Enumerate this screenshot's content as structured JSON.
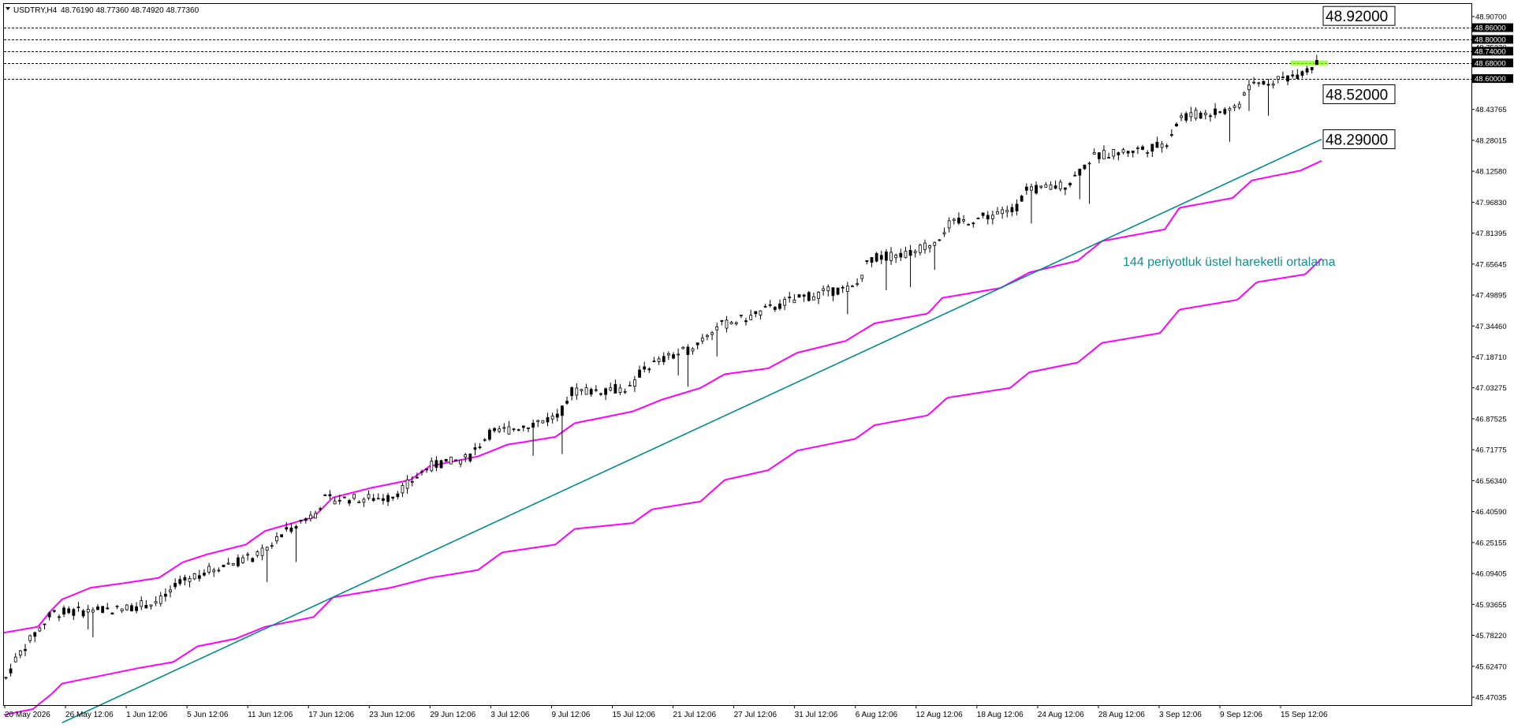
{
  "header": {
    "symbol": "USDTRY,H4",
    "ohlc": "48.76190 48.77360 48.74920 48.77360"
  },
  "colors": {
    "background": "#ffffff",
    "frame": "#000000",
    "candle": "#000000",
    "band": "#ff00ff",
    "ema": "#008b8b",
    "annotation": "#138f8f",
    "level_line": "#000000",
    "highlight": "#7fff00"
  },
  "annotation_text": "144 periyotluk üstel hareketli ortalama",
  "price_tags": [
    {
      "name": "upper-band-tag",
      "text": "48.92000"
    },
    {
      "name": "lower-band-tag",
      "text": "48.52000"
    },
    {
      "name": "ema-tag",
      "text": "48.29000"
    }
  ],
  "chart_data": {
    "type": "candlestick",
    "title": "USDTRY,H4",
    "ylim": [
      45.4,
      48.965
    ],
    "y_ticks": [
      "48.90700",
      "48.75270",
      "48.59180",
      "48.43765",
      "48.28015",
      "48.12580",
      "47.96830",
      "47.81395",
      "47.65645",
      "47.49895",
      "47.34460",
      "47.18710",
      "47.03275",
      "46.87525",
      "46.71775",
      "46.56340",
      "46.40590",
      "46.25155",
      "46.09405",
      "45.93655",
      "45.78220",
      "45.62470",
      "45.47035"
    ],
    "x_ticks": [
      "20 May 2026",
      "26 May 12:06",
      "1 Jun 12:06",
      "5 Jun 12:06",
      "11 Jun 12:06",
      "17 Jun 12:06",
      "23 Jun 12:06",
      "29 Jun 12:06",
      "3 Jul 12:06",
      "9 Jul 12:06",
      "15 Jul 12:06",
      "21 Jul 12:06",
      "27 Jul 12:06",
      "31 Jul 12:06",
      "6 Aug 12:06",
      "12 Aug 12:06",
      "18 Aug 12:06",
      "24 Aug 12:06",
      "28 Aug 12:06",
      "3 Sep 12:06",
      "9 Sep 12:06",
      "15 Sep 12:06"
    ],
    "horizontal_levels": [
      {
        "price": 48.86,
        "label": "48.86000"
      },
      {
        "price": 48.8,
        "label": "48.80000"
      },
      {
        "price": 48.74,
        "label": "48.74000"
      },
      {
        "price": 48.68,
        "label": "48.68000"
      },
      {
        "price": 48.6,
        "label": "48.60000"
      }
    ],
    "price_path": [
      [
        0,
        45.52
      ],
      [
        14,
        45.65
      ],
      [
        25,
        45.72
      ],
      [
        50,
        45.87
      ],
      [
        120,
        45.89
      ],
      [
        160,
        45.93
      ],
      [
        190,
        46.05
      ],
      [
        230,
        46.12
      ],
      [
        262,
        46.16
      ],
      [
        300,
        46.32
      ],
      [
        322,
        46.38
      ],
      [
        330,
        46.45
      ],
      [
        400,
        46.46
      ],
      [
        440,
        46.62
      ],
      [
        480,
        46.66
      ],
      [
        500,
        46.78
      ],
      [
        540,
        46.83
      ],
      [
        575,
        46.88
      ],
      [
        585,
        47.0
      ],
      [
        650,
        47.02
      ],
      [
        660,
        47.12
      ],
      [
        710,
        47.22
      ],
      [
        735,
        47.33
      ],
      [
        770,
        47.38
      ],
      [
        810,
        47.46
      ],
      [
        850,
        47.51
      ],
      [
        880,
        47.53
      ],
      [
        895,
        47.68
      ],
      [
        940,
        47.71
      ],
      [
        965,
        47.78
      ],
      [
        975,
        47.85
      ],
      [
        1045,
        47.93
      ],
      [
        1055,
        48.02
      ],
      [
        1100,
        48.06
      ],
      [
        1125,
        48.2
      ],
      [
        1200,
        48.26
      ],
      [
        1215,
        48.4
      ],
      [
        1275,
        48.45
      ],
      [
        1285,
        48.56
      ],
      [
        1330,
        48.61
      ],
      [
        1350,
        48.65
      ],
      [
        1362,
        48.7
      ]
    ],
    "upper_band": [
      [
        0,
        45.77
      ],
      [
        35,
        45.8
      ],
      [
        50,
        45.89
      ],
      [
        60,
        45.94
      ],
      [
        90,
        46.0
      ],
      [
        120,
        46.02
      ],
      [
        160,
        46.05
      ],
      [
        185,
        46.13
      ],
      [
        210,
        46.17
      ],
      [
        250,
        46.22
      ],
      [
        270,
        46.29
      ],
      [
        320,
        46.36
      ],
      [
        340,
        46.46
      ],
      [
        380,
        46.51
      ],
      [
        420,
        46.55
      ],
      [
        440,
        46.62
      ],
      [
        490,
        46.67
      ],
      [
        520,
        46.73
      ],
      [
        570,
        46.77
      ],
      [
        590,
        46.84
      ],
      [
        650,
        46.9
      ],
      [
        680,
        46.96
      ],
      [
        720,
        47.02
      ],
      [
        745,
        47.09
      ],
      [
        790,
        47.12
      ],
      [
        820,
        47.2
      ],
      [
        870,
        47.26
      ],
      [
        900,
        47.35
      ],
      [
        955,
        47.4
      ],
      [
        970,
        47.48
      ],
      [
        1030,
        47.53
      ],
      [
        1060,
        47.61
      ],
      [
        1110,
        47.67
      ],
      [
        1135,
        47.77
      ],
      [
        1200,
        47.83
      ],
      [
        1215,
        47.94
      ],
      [
        1270,
        47.99
      ],
      [
        1290,
        48.08
      ],
      [
        1340,
        48.13
      ],
      [
        1362,
        48.18
      ]
    ],
    "lower_band": [
      [
        0,
        45.35
      ],
      [
        30,
        45.38
      ],
      [
        50,
        45.46
      ],
      [
        60,
        45.51
      ],
      [
        100,
        45.55
      ],
      [
        140,
        45.59
      ],
      [
        175,
        45.62
      ],
      [
        200,
        45.7
      ],
      [
        240,
        45.74
      ],
      [
        270,
        45.8
      ],
      [
        320,
        45.85
      ],
      [
        340,
        45.95
      ],
      [
        400,
        46.0
      ],
      [
        440,
        46.05
      ],
      [
        490,
        46.09
      ],
      [
        515,
        46.18
      ],
      [
        570,
        46.22
      ],
      [
        590,
        46.3
      ],
      [
        650,
        46.33
      ],
      [
        670,
        46.4
      ],
      [
        720,
        46.44
      ],
      [
        745,
        46.55
      ],
      [
        790,
        46.6
      ],
      [
        820,
        46.7
      ],
      [
        880,
        46.76
      ],
      [
        900,
        46.83
      ],
      [
        955,
        46.88
      ],
      [
        975,
        46.97
      ],
      [
        1040,
        47.02
      ],
      [
        1060,
        47.1
      ],
      [
        1110,
        47.15
      ],
      [
        1135,
        47.25
      ],
      [
        1195,
        47.3
      ],
      [
        1215,
        47.42
      ],
      [
        1275,
        47.47
      ],
      [
        1295,
        47.56
      ],
      [
        1345,
        47.6
      ],
      [
        1362,
        47.68
      ]
    ],
    "ema_144": [
      [
        60,
        45.31
      ],
      [
        1362,
        48.29
      ]
    ]
  }
}
